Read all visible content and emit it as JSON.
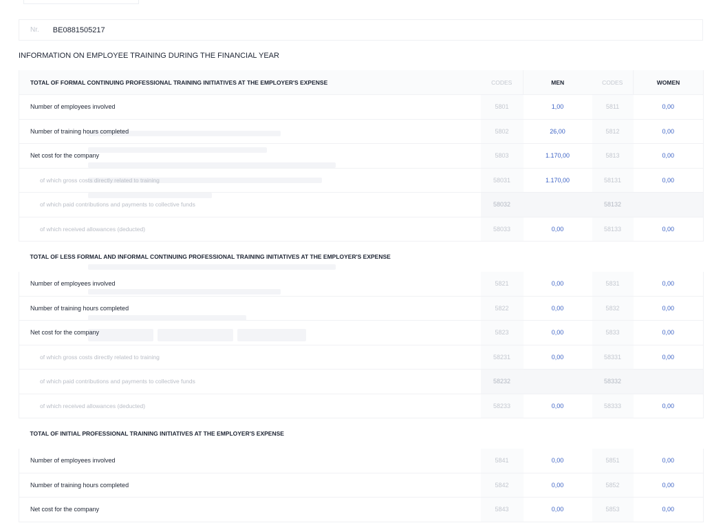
{
  "identifier": {
    "label": "Nr.",
    "value": "BE0881505217"
  },
  "section_title": "INFORMATION ON EMPLOYEE TRAINING DURING THE FINANCIAL YEAR",
  "columns": {
    "codes": "CODES",
    "men": "MEN",
    "women": "WOMEN"
  },
  "groups": [
    {
      "title": "TOTAL OF FORMAL CONTINUING PROFESSIONAL TRAINING INITIATIVES AT THE EMPLOYER'S EXPENSE",
      "rows": [
        {
          "label": "Number of employees involved",
          "code_men": "5801",
          "men": "1,00",
          "code_women": "5811",
          "women": "0,00",
          "sub": false
        },
        {
          "label": "Number of training hours completed",
          "code_men": "5802",
          "men": "26,00",
          "code_women": "5812",
          "women": "0,00",
          "sub": false
        },
        {
          "label": "Net cost for the company",
          "code_men": "5803",
          "men": "1.170,00",
          "code_women": "5813",
          "women": "0,00",
          "sub": false
        },
        {
          "label": "of which gross costs directly related to training",
          "code_men": "58031",
          "men": "1.170,00",
          "code_women": "58131",
          "women": "0,00",
          "sub": true
        },
        {
          "label": "of which paid contributions and payments to collective funds",
          "code_men": "58032",
          "men": "",
          "code_women": "58132",
          "women": "",
          "sub": true
        },
        {
          "label": "of which received allowances (deducted)",
          "code_men": "58033",
          "men": "0,00",
          "code_women": "58133",
          "women": "0,00",
          "sub": true
        }
      ]
    },
    {
      "title": "TOTAL OF LESS FORMAL AND INFORMAL CONTINUING PROFESSIONAL TRAINING INITIATIVES AT THE EMPLOYER'S EXPENSE",
      "rows": [
        {
          "label": "Number of employees involved",
          "code_men": "5821",
          "men": "0,00",
          "code_women": "5831",
          "women": "0,00",
          "sub": false
        },
        {
          "label": "Number of training hours completed",
          "code_men": "5822",
          "men": "0,00",
          "code_women": "5832",
          "women": "0,00",
          "sub": false
        },
        {
          "label": "Net cost for the company",
          "code_men": "5823",
          "men": "0,00",
          "code_women": "5833",
          "women": "0,00",
          "sub": false
        },
        {
          "label": "of which gross costs directly related to training",
          "code_men": "58231",
          "men": "0,00",
          "code_women": "58331",
          "women": "0,00",
          "sub": true
        },
        {
          "label": "of which paid contributions and payments to collective funds",
          "code_men": "58232",
          "men": "",
          "code_women": "58332",
          "women": "",
          "sub": true
        },
        {
          "label": "of which received allowances (deducted)",
          "code_men": "58233",
          "men": "0,00",
          "code_women": "58333",
          "women": "0,00",
          "sub": true
        }
      ]
    },
    {
      "title": "TOTAL OF INITIAL PROFESSIONAL TRAINING INITIATIVES AT THE EMPLOYER'S EXPENSE",
      "rows": [
        {
          "label": "Number of employees involved",
          "code_men": "5841",
          "men": "0,00",
          "code_women": "5851",
          "women": "0,00",
          "sub": false
        },
        {
          "label": "Number of training hours completed",
          "code_men": "5842",
          "men": "0,00",
          "code_women": "5852",
          "women": "0,00",
          "sub": false
        },
        {
          "label": "Net cost for the company",
          "code_men": "5843",
          "men": "0,00",
          "code_women": "5853",
          "women": "0,00",
          "sub": false
        }
      ]
    }
  ],
  "colors": {
    "value_blue": "#3d63c5",
    "code_grey": "#c3c7cf",
    "border": "#f0f1f4"
  }
}
